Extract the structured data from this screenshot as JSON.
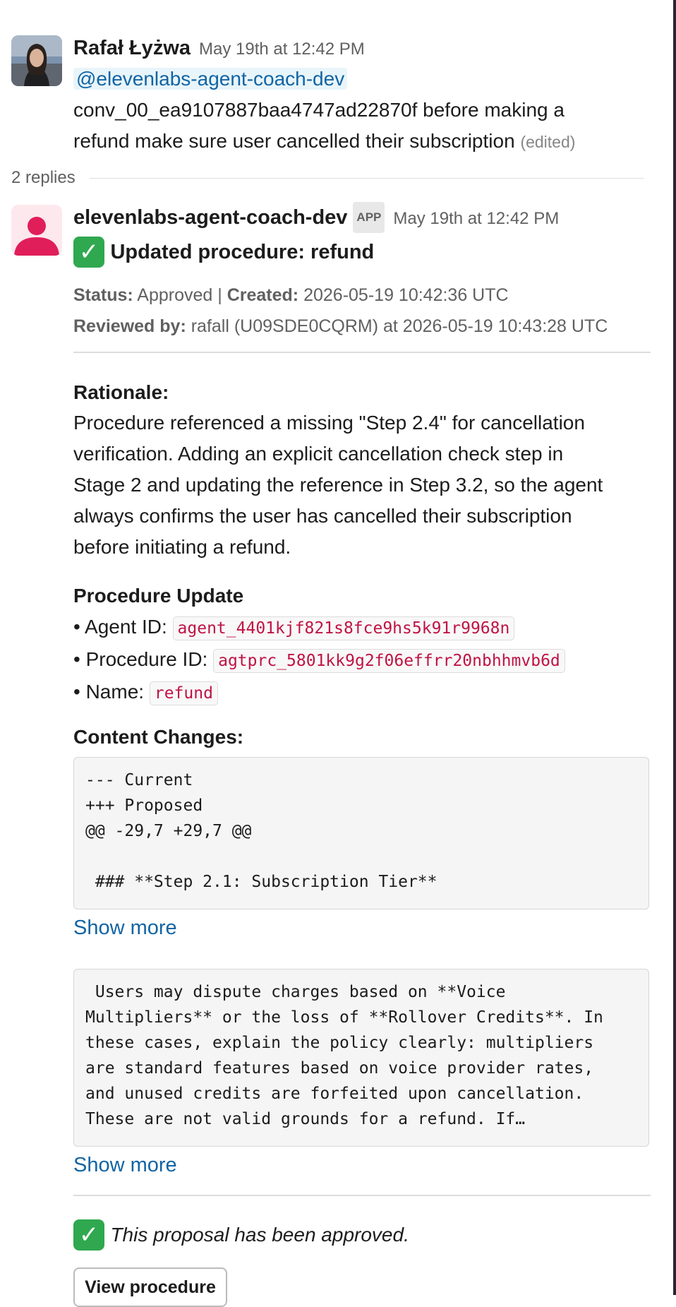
{
  "message1": {
    "author": "Rafał Łyżwa",
    "timestamp": "May 19th at 12:42 PM",
    "mention": "@elevenlabs-agent-coach-dev",
    "text_line1": "conv_00_ea9107887baa4747ad22870f before making a",
    "text_line2": "refund make sure user cancelled their subscription",
    "edited": "(edited)"
  },
  "thread": {
    "replies": "2 replies"
  },
  "message2": {
    "author": "elevenlabs-agent-coach-dev",
    "badge": "APP",
    "timestamp": "May 19th at 12:42 PM",
    "title": "Updated procedure: refund",
    "status_label": "Status:",
    "status_value": " Approved | ",
    "created_label": "Created:",
    "created_value": " 2026-05-19 10:42:36 UTC",
    "reviewed_label": "Reviewed by:",
    "reviewed_value": " rafall (U09SDE0CQRM) at 2026-05-19 10:43:28 UTC",
    "rationale_title": "Rationale:",
    "rationale_lines": [
      "Procedure referenced a missing \"Step 2.4\" for cancellation",
      "verification. Adding an explicit cancellation check step in",
      "Stage 2 and updating the reference in Step 3.2, so the agent",
      "always confirms the user has cancelled their subscription",
      "before initiating a refund."
    ],
    "update_title": "Procedure Update",
    "agent_label": "• Agent ID: ",
    "agent_id": "agent_4401kjf821s8fce9hs5k91r9968n",
    "procedure_label": "• Procedure ID: ",
    "procedure_id": "agtprc_5801kk9g2f06effrr20nbhhmvb6d",
    "name_label": "• Name: ",
    "name_value": "refund",
    "changes_title": "Content Changes:",
    "code1": "--- Current\n+++ Proposed\n@@ -29,7 +29,7 @@\n\n ### **Step 2.1: Subscription Tier**",
    "show_more_1": "Show more",
    "code2": " Users may dispute charges based on **Voice\nMultipliers** or the loss of **Rollover Credits**. In\nthese cases, explain the policy clearly: multipliers\nare standard features based on voice provider rates,\nand unused credits are forfeited upon cancellation.\nThese are not valid grounds for a refund. If…",
    "show_more_2": "Show more",
    "approved_text": "This proposal has been approved.",
    "view_button": "View procedure"
  },
  "colors": {
    "link": "#1264a3",
    "code_text": "#c01343",
    "check_green": "#2fa84f",
    "bot_avatar": "#e01e5a"
  }
}
